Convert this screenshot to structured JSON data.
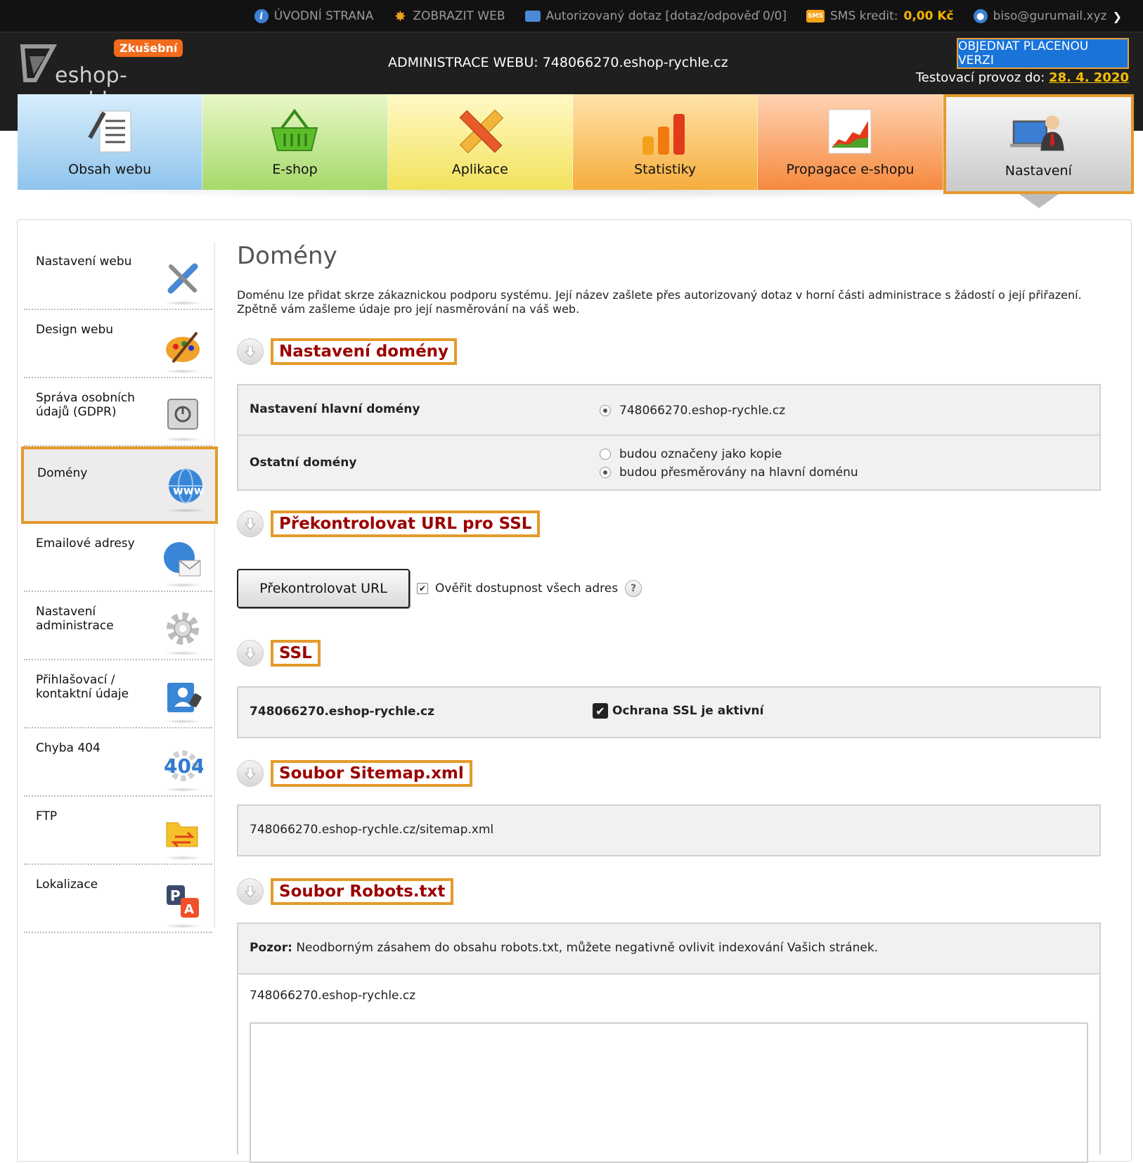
{
  "topbar": {
    "home": "ÚVODNÍ STRANA",
    "show_web": "ZOBRAZIT WEB",
    "query": "Autorizovaný dotaz [dotaz/odpověď 0/0]",
    "sms_label": "SMS kredit:",
    "sms_value": "0,00 Kč",
    "user": "biso@gurumail.xyz",
    "sms_icon_text": "SMS"
  },
  "header": {
    "logo_text": "eshop-rychle",
    "logo_badge": "Zkušební",
    "admin_title": "ADMINISTRACE WEBU: 748066270.eshop-rychle.cz",
    "order_button": "OBJEDNAT PLACENOU VERZI",
    "trial_label": "Testovací provoz do:",
    "trial_date": "28. 4. 2020"
  },
  "tabs": [
    {
      "label": "Obsah webu",
      "icon": "document-list-icon"
    },
    {
      "label": "E-shop",
      "icon": "basket-icon"
    },
    {
      "label": "Aplikace",
      "icon": "pencil-ruler-icon"
    },
    {
      "label": "Statistiky",
      "icon": "bar-chart-icon"
    },
    {
      "label": "Propagace e-shopu",
      "icon": "growth-chart-icon"
    },
    {
      "label": "Nastavení",
      "icon": "admin-person-icon",
      "active": true
    }
  ],
  "sidebar": {
    "items": [
      {
        "label": "Nastavení webu",
        "icon": "tools-icon"
      },
      {
        "label": "Design webu",
        "icon": "palette-icon"
      },
      {
        "label": "Správa osobních údajů (GDPR)",
        "icon": "safe-icon"
      },
      {
        "label": "Domény",
        "icon": "www-globe-icon",
        "active": true
      },
      {
        "label": "Emailové adresy",
        "icon": "email-globe-icon"
      },
      {
        "label": "Nastavení administrace",
        "icon": "gear-icon"
      },
      {
        "label": "Přihlašovací / kontaktní údaje",
        "icon": "contact-card-icon"
      },
      {
        "label": "Chyba 404",
        "icon": "error-404-icon"
      },
      {
        "label": "FTP",
        "icon": "ftp-folder-icon"
      },
      {
        "label": "Lokalizace",
        "icon": "localization-icon"
      }
    ]
  },
  "main": {
    "title": "Domény",
    "intro": "Doménu lze přidat skrze zákaznickou podporu systému. Její název zašlete přes autorizovaný dotaz v horní části administrace s žádostí o její přiřazení. Zpětně vám zašleme údaje pro její nasměrování na váš web.",
    "domain_settings": {
      "title": "Nastavení domény",
      "main_domain_label": "Nastavení hlavní domény",
      "main_domain_value": "748066270.eshop-rychle.cz",
      "other_domains_label": "Ostatní domény",
      "option_copy": "budou označeny jako kopie",
      "option_redirect": "budou přesměrovány na hlavní doménu",
      "selected_option": "redirect"
    },
    "ssl_check": {
      "title": "Překontrolovat URL pro SSL",
      "button": "Překontrolovat URL",
      "checkbox_label": "Ověřit dostupnost všech adres",
      "checkbox_checked": true,
      "help": "?"
    },
    "ssl": {
      "title": "SSL",
      "domain": "748066270.eshop-rychle.cz",
      "status": "Ochrana SSL je aktivní",
      "checked": true
    },
    "sitemap": {
      "title": "Soubor Sitemap.xml",
      "url": "748066270.eshop-rychle.cz/sitemap.xml"
    },
    "robots": {
      "title": "Soubor Robots.txt",
      "warning_bold": "Pozor:",
      "warning_text": "Neodborným zásahem do obsahu robots.txt, můžete negativně ovlivit indexování Vašich stránek.",
      "domain": "748066270.eshop-rychle.cz",
      "content": ""
    }
  },
  "colors": {
    "highlight": "#e49a2c",
    "section_title": "#9b0000",
    "accent_blue": "#1a73d9",
    "trial_date": "#f5c000"
  }
}
